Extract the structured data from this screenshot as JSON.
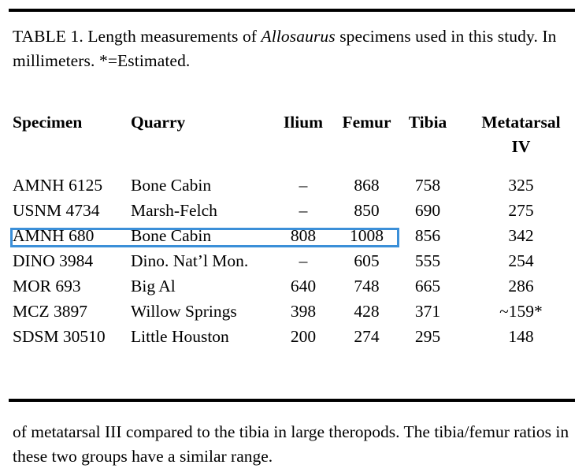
{
  "document": {
    "caption_prefix": "TABLE 1.  Length measurements of ",
    "caption_italic": "Allosaurus",
    "caption_suffix": " specimens used in this study.  In millimeters.  *=Estimated."
  },
  "table": {
    "headers": {
      "specimen": "Specimen",
      "quarry": "Quarry",
      "ilium": "Ilium",
      "femur": "Femur",
      "tibia": "Tibia",
      "metatarsal_line1": "Metatarsal",
      "metatarsal_line2": "IV"
    },
    "rows": [
      {
        "specimen": "AMNH 6125",
        "quarry": "Bone Cabin",
        "ilium": "–",
        "femur": "868",
        "tibia": "758",
        "metatarsal_iv": "325"
      },
      {
        "specimen": "USNM 4734",
        "quarry": "Marsh-Felch",
        "ilium": "–",
        "femur": "850",
        "tibia": "690",
        "metatarsal_iv": "275"
      },
      {
        "specimen": "AMNH 680",
        "quarry": "Bone Cabin",
        "ilium": "808",
        "femur": "1008",
        "tibia": "856",
        "metatarsal_iv": "342"
      },
      {
        "specimen": "DINO 3984",
        "quarry": "Dino. Nat’l Mon.",
        "ilium": "–",
        "femur": "605",
        "tibia": "555",
        "metatarsal_iv": "254"
      },
      {
        "specimen": "MOR 693",
        "quarry": "Big Al",
        "ilium": "640",
        "femur": "748",
        "tibia": "665",
        "metatarsal_iv": "286"
      },
      {
        "specimen": "MCZ 3897",
        "quarry": "Willow Springs",
        "ilium": "398",
        "femur": "428",
        "tibia": "371",
        "metatarsal_iv": "~159*"
      },
      {
        "specimen": "SDSM 30510",
        "quarry": "Little Houston",
        "ilium": "200",
        "femur": "274",
        "tibia": "295",
        "metatarsal_iv": "148"
      }
    ]
  },
  "selection": {
    "highlight_color": "#3b8fd8",
    "row_specimen": "AMNH 680"
  },
  "footer": {
    "text": "of metatarsal III compared to the tibia in large theropods.  The tibia/femur ratios in these two groups have a similar range."
  }
}
